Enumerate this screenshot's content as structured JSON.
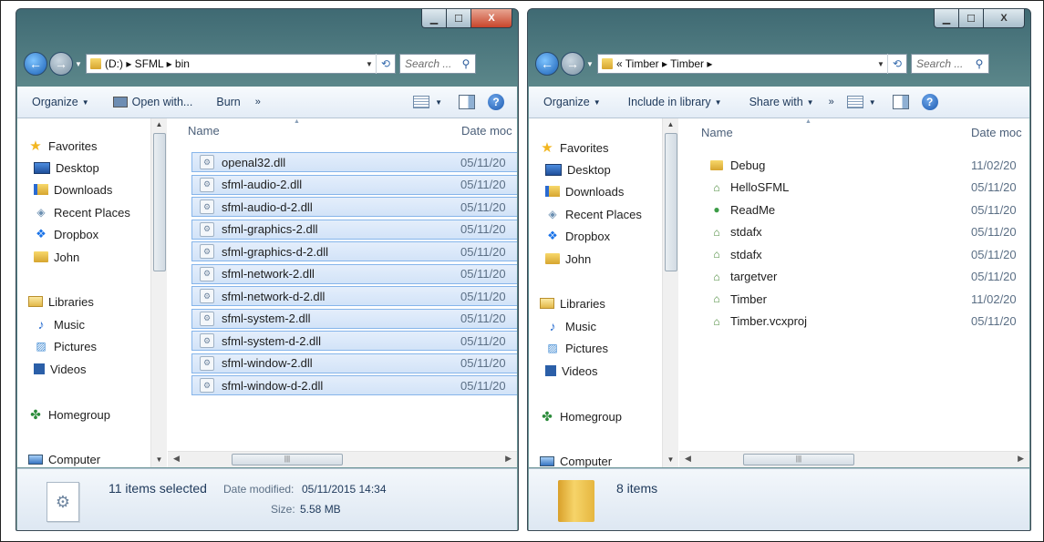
{
  "left_window": {
    "breadcrumb": "(D:) ▸ SFML ▸ bin",
    "search_placeholder": "Search ...",
    "toolbar": {
      "organize": "Organize",
      "open_with": "Open with...",
      "burn": "Burn",
      "more": "»"
    },
    "nav": [
      {
        "label": "Favorites",
        "icon": "star-icon"
      },
      {
        "label": "Desktop",
        "icon": "desktop-icon"
      },
      {
        "label": "Downloads",
        "icon": "downloads-icon"
      },
      {
        "label": "Recent Places",
        "icon": "recent-places-icon"
      },
      {
        "label": "Dropbox",
        "icon": "dropbox-icon"
      },
      {
        "label": "John",
        "icon": "folder-icon"
      },
      {
        "label": "Libraries",
        "icon": "libraries-icon"
      },
      {
        "label": "Music",
        "icon": "music-icon"
      },
      {
        "label": "Pictures",
        "icon": "pictures-icon"
      },
      {
        "label": "Videos",
        "icon": "videos-icon"
      },
      {
        "label": "Homegroup",
        "icon": "homegroup-icon"
      },
      {
        "label": "Computer",
        "icon": "computer-icon"
      }
    ],
    "columns": {
      "name": "Name",
      "date": "Date moc"
    },
    "files": [
      {
        "name": "openal32.dll",
        "date": "05/11/20"
      },
      {
        "name": "sfml-audio-2.dll",
        "date": "05/11/20"
      },
      {
        "name": "sfml-audio-d-2.dll",
        "date": "05/11/20"
      },
      {
        "name": "sfml-graphics-2.dll",
        "date": "05/11/20"
      },
      {
        "name": "sfml-graphics-d-2.dll",
        "date": "05/11/20"
      },
      {
        "name": "sfml-network-2.dll",
        "date": "05/11/20"
      },
      {
        "name": "sfml-network-d-2.dll",
        "date": "05/11/20"
      },
      {
        "name": "sfml-system-2.dll",
        "date": "05/11/20"
      },
      {
        "name": "sfml-system-d-2.dll",
        "date": "05/11/20"
      },
      {
        "name": "sfml-window-2.dll",
        "date": "05/11/20"
      },
      {
        "name": "sfml-window-d-2.dll",
        "date": "05/11/20"
      }
    ],
    "details": {
      "count": "11 items selected",
      "date_label": "Date modified:",
      "date_value": "05/11/2015 14:34",
      "size_label": "Size:",
      "size_value": "5.58 MB"
    }
  },
  "right_window": {
    "breadcrumb": "« Timber ▸ Timber ▸",
    "search_placeholder": "Search ...",
    "toolbar": {
      "organize": "Organize",
      "include": "Include in library",
      "share": "Share with",
      "more": "»"
    },
    "nav": [
      {
        "label": "Favorites",
        "icon": "star-icon"
      },
      {
        "label": "Desktop",
        "icon": "desktop-icon"
      },
      {
        "label": "Downloads",
        "icon": "downloads-icon"
      },
      {
        "label": "Recent Places",
        "icon": "recent-places-icon"
      },
      {
        "label": "Dropbox",
        "icon": "dropbox-icon"
      },
      {
        "label": "John",
        "icon": "folder-icon"
      },
      {
        "label": "Libraries",
        "icon": "libraries-icon"
      },
      {
        "label": "Music",
        "icon": "music-icon"
      },
      {
        "label": "Pictures",
        "icon": "pictures-icon"
      },
      {
        "label": "Videos",
        "icon": "videos-icon"
      },
      {
        "label": "Homegroup",
        "icon": "homegroup-icon"
      },
      {
        "label": "Computer",
        "icon": "computer-icon"
      }
    ],
    "columns": {
      "name": "Name",
      "date": "Date moc"
    },
    "files": [
      {
        "name": "Debug",
        "date": "11/02/20",
        "icon": "folder-icon"
      },
      {
        "name": "HelloSFML",
        "date": "05/11/20",
        "icon": "vs-project-icon"
      },
      {
        "name": "ReadMe",
        "date": "05/11/20",
        "icon": "text-file-icon"
      },
      {
        "name": "stdafx",
        "date": "05/11/20",
        "icon": "cpp-source-icon"
      },
      {
        "name": "stdafx",
        "date": "05/11/20",
        "icon": "header-file-icon"
      },
      {
        "name": "targetver",
        "date": "05/11/20",
        "icon": "header-file-icon"
      },
      {
        "name": "Timber",
        "date": "11/02/20",
        "icon": "cpp-source-icon"
      },
      {
        "name": "Timber.vcxproj",
        "date": "05/11/20",
        "icon": "vcxproj-icon"
      }
    ],
    "details": {
      "count": "8 items"
    }
  }
}
